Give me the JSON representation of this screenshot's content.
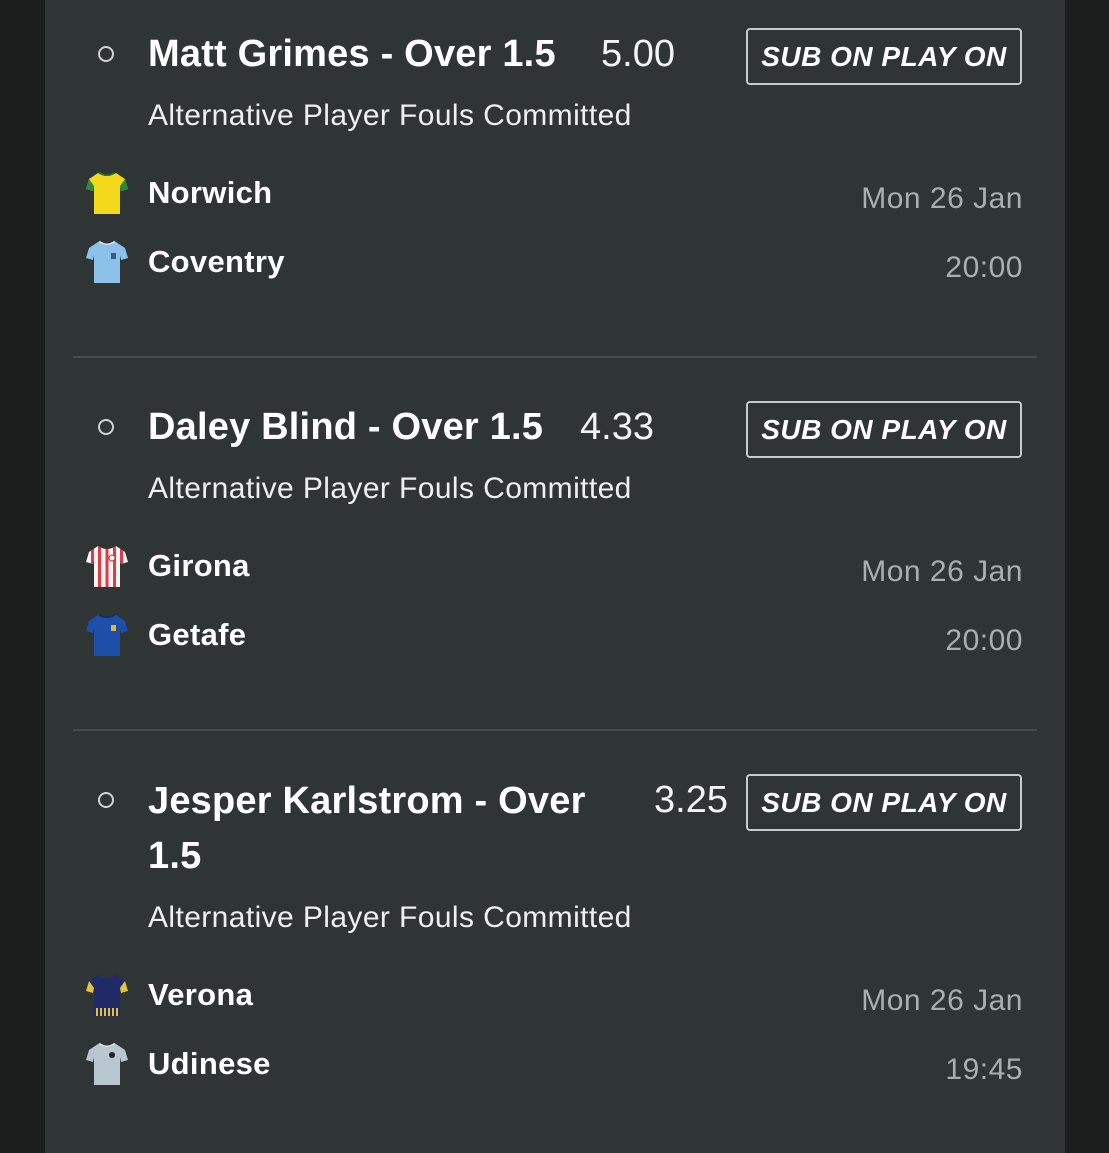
{
  "bets": [
    {
      "selection": "Matt Grimes - Over 1.5",
      "odds": "5.00",
      "action_label": "SUB ON PLAY ON",
      "market": "Alternative Player Fouls Committed",
      "home_team": "Norwich",
      "away_team": "Coventry",
      "date": "Mon 26 Jan",
      "time": "20:00",
      "home_kit_icon": "norwich-kit-icon",
      "away_kit_icon": "coventry-kit-icon"
    },
    {
      "selection": "Daley Blind - Over 1.5",
      "odds": "4.33",
      "action_label": "SUB ON PLAY ON",
      "market": "Alternative Player Fouls Committed",
      "home_team": "Girona",
      "away_team": "Getafe",
      "date": "Mon 26 Jan",
      "time": "20:00",
      "home_kit_icon": "girona-kit-icon",
      "away_kit_icon": "getafe-kit-icon"
    },
    {
      "selection": "Jesper Karlstrom - Over 1.5",
      "odds": "3.25",
      "action_label": "SUB ON PLAY ON",
      "market": "Alternative Player Fouls Committed",
      "home_team": "Verona",
      "away_team": "Udinese",
      "date": "Mon 26 Jan",
      "time": "19:45",
      "home_kit_icon": "verona-kit-icon",
      "away_kit_icon": "udinese-kit-icon"
    }
  ],
  "colors": {
    "background": "#1c1e1e",
    "panel": "#2f3434",
    "muted_text": "#a9afaf",
    "divider": "#474d4d"
  }
}
